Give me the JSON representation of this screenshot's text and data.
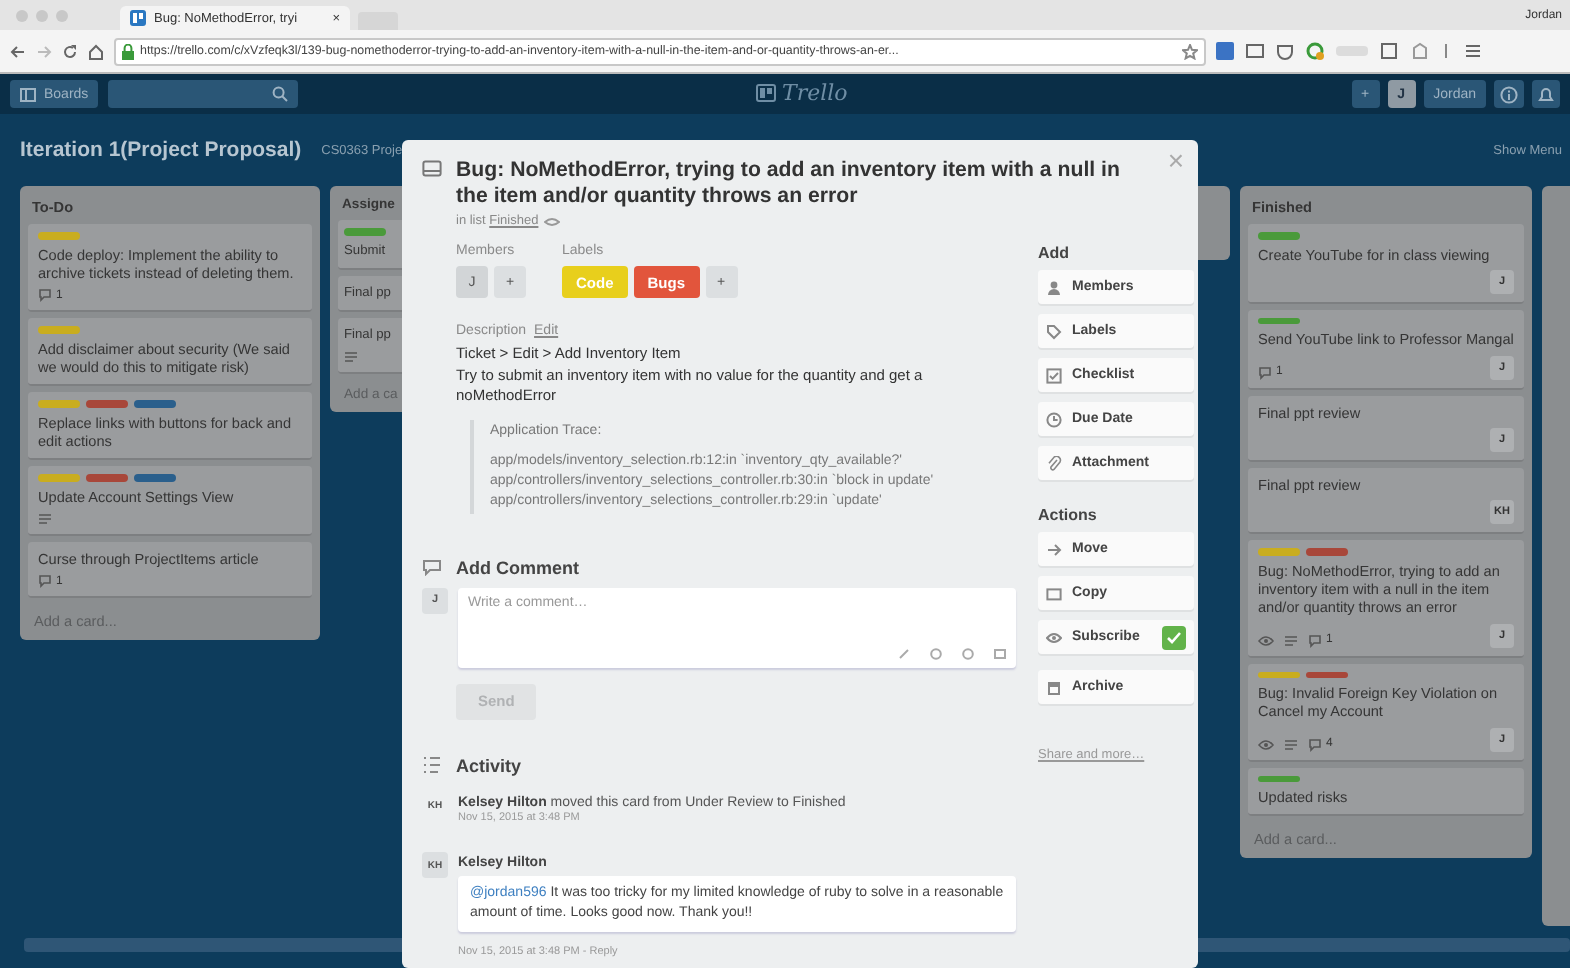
{
  "browser": {
    "tab": {
      "title": "Bug: NoMethodError, tryi",
      "close": "×"
    },
    "url": "https://trello.com/c/xVzfeqk3l/139-bug-nomethoderror-trying-to-add-an-inventory-item-with-a-null-in-the-item-and-or-quantity-throws-an-er...",
    "profile": "Jordan"
  },
  "header": {
    "boards": "Boards",
    "logo": "Trello",
    "add": "+",
    "avatar": "J",
    "user": "Jordan"
  },
  "board": {
    "title": "Iteration 1(Project Proposal)",
    "team": "CS0363 Proje",
    "menu": "Show Menu"
  },
  "lists": [
    {
      "title": "To-Do",
      "add_card": "Add a card...",
      "cards": [
        {
          "labels": [
            {
              "color": "#c9ad1f"
            }
          ],
          "text": "Code deploy: Implement the ability to archive tickets instead of deleting them.",
          "badges": [
            {
              "kind": "comments",
              "count": "1"
            }
          ]
        },
        {
          "labels": [
            {
              "color": "#c9ad1f"
            }
          ],
          "text": "Add disclaimer about security (We said we would do this to mitigate risk)"
        },
        {
          "labels": [
            {
              "color": "#c9ad1f"
            },
            {
              "color": "#a8473a"
            },
            {
              "color": "#2a5f8c"
            }
          ],
          "text": "Replace links with buttons for back and edit actions"
        },
        {
          "labels": [
            {
              "color": "#c9ad1f"
            },
            {
              "color": "#a8473a"
            },
            {
              "color": "#2a5f8c"
            }
          ],
          "text": "Update Account Settings View",
          "badges": [
            {
              "kind": "description"
            }
          ]
        },
        {
          "text": "Curse through ProjectItems article",
          "badges": [
            {
              "kind": "comments",
              "count": "1"
            }
          ]
        }
      ]
    },
    {
      "title": "Assigne",
      "add_card": "Add a ca",
      "cards": [
        {
          "labels": [
            {
              "color": "#4a9a3a"
            }
          ],
          "text": "Submit"
        },
        {
          "text": "Final pp"
        },
        {
          "text": "Final pp",
          "badges": [
            {
              "kind": "description"
            }
          ]
        }
      ]
    },
    {
      "title": "Finished",
      "add_card": "Add a card...",
      "cards": [
        {
          "labels": [
            {
              "color": "#4a9a3a"
            }
          ],
          "text": "Create YouTube for in class viewing",
          "member": "J"
        },
        {
          "labels": [
            {
              "color": "#4a9a3a"
            }
          ],
          "text": "Send YouTube link to Professor Mangal",
          "badges": [
            {
              "kind": "comments",
              "count": "1"
            }
          ],
          "member": "J"
        },
        {
          "text": "Final ppt review",
          "member": "J"
        },
        {
          "text": "Final ppt review",
          "member": "KH"
        },
        {
          "labels": [
            {
              "color": "#c9ad1f"
            },
            {
              "color": "#a8473a"
            }
          ],
          "text": "Bug: NoMethodError, trying to add an inventory item with a null in the item and/or quantity throws an error",
          "badges": [
            {
              "kind": "watch"
            },
            {
              "kind": "description"
            },
            {
              "kind": "comments",
              "count": "1"
            }
          ],
          "member": "J"
        },
        {
          "labels": [
            {
              "color": "#c9ad1f"
            },
            {
              "color": "#a8473a"
            }
          ],
          "text": "Bug: Invalid Foreign Key Violation on Cancel my Account",
          "badges": [
            {
              "kind": "watch"
            },
            {
              "kind": "description"
            },
            {
              "kind": "comments",
              "count": "4"
            }
          ],
          "member": "J"
        },
        {
          "labels": [
            {
              "color": "#4a9a3a"
            }
          ],
          "text": "Updated risks"
        }
      ]
    }
  ],
  "card": {
    "title": "Bug: NoMethodError, trying to add an inventory item with a null in the item and/or quantity throws an error",
    "list_prefix": "in list",
    "list_name": "Finished",
    "close": "×",
    "members_heading": "Members",
    "members": [
      "J"
    ],
    "member_add": "+",
    "labels_heading": "Labels",
    "labels": [
      {
        "text": "Code",
        "color": "#e8cf1c"
      },
      {
        "text": "Bugs",
        "color": "#e2553c"
      }
    ],
    "label_add": "+",
    "description": {
      "heading": "Description",
      "edit": "Edit",
      "lines": [
        "Ticket > Edit > Add Inventory Item",
        "Try to submit an inventory item with no value for the quantity and get a noMethodError"
      ],
      "quote_heading": "Application Trace:",
      "quote_lines": [
        "app/models/inventory_selection.rb:12:in `inventory_qty_available?'",
        "app/controllers/inventory_selections_controller.rb:30:in `block in update'",
        "app/controllers/inventory_selections_controller.rb:29:in `update'"
      ]
    },
    "comment_form": {
      "heading": "Add Comment",
      "avatar": "J",
      "placeholder": "Write a comment…",
      "send": "Send",
      "send_disabled": true
    },
    "activity": {
      "heading": "Activity",
      "items": [
        {
          "kind": "action",
          "avatar": "KH",
          "text": "**Kelsey Hilton** moved this card from Under Review to Finished",
          "time": "Nov 15, 2015 at 3:48 PM"
        },
        {
          "kind": "comment",
          "avatar": "KH",
          "author": "Kelsey Hilton",
          "mention": "@jordan596",
          "text": "It was too tricky for my limited knowledge of ruby to solve in a reasonable amount of time. Looks good now. Thank you!!",
          "time": "Nov 15, 2015 at 3:48 PM - Reply"
        }
      ]
    },
    "sidebar": {
      "add_heading": "Add",
      "add_buttons": [
        "Members",
        "Labels",
        "Checklist",
        "Due Date",
        "Attachment"
      ],
      "actions_heading": "Actions",
      "actions": [
        {
          "label": "Move",
          "checked": false
        },
        {
          "label": "Copy",
          "checked": false
        },
        {
          "label": "Subscribe",
          "checked": true
        },
        {
          "label": "Archive",
          "checked": false
        }
      ],
      "share": "Share and more…"
    }
  }
}
